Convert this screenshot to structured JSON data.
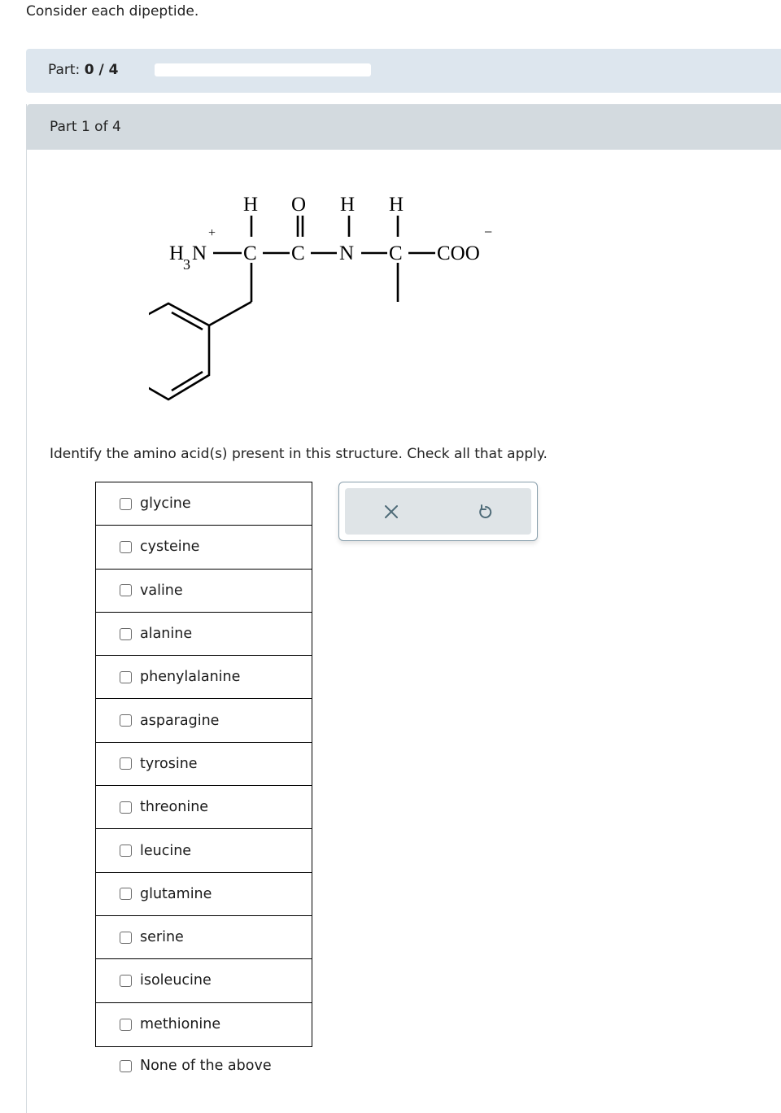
{
  "intro_text": "Consider each dipeptide.",
  "progress": {
    "label_prefix": "Part:",
    "value_text": "0 / 4",
    "completed": 0,
    "total": 4,
    "fraction": 0
  },
  "part": {
    "header": "Part 1 of 4",
    "question": "Identify the amino acid(s) present in this structure. Check all that apply.",
    "structure": {
      "top_labels": [
        "H",
        "O",
        "H",
        "H"
      ],
      "backbone_labels": [
        "N",
        "C",
        "C",
        "N",
        "C",
        "COO"
      ],
      "n_terminus": "H",
      "n_terminus_subscript": "3",
      "plus_charge": "+",
      "minus_charge": "−"
    },
    "choices": [
      {
        "label": "glycine",
        "checked": false
      },
      {
        "label": "cysteine",
        "checked": false
      },
      {
        "label": "valine",
        "checked": false
      },
      {
        "label": "alanine",
        "checked": false
      },
      {
        "label": "phenylalanine",
        "checked": false
      },
      {
        "label": "asparagine",
        "checked": false
      },
      {
        "label": "tyrosine",
        "checked": false
      },
      {
        "label": "threonine",
        "checked": false
      },
      {
        "label": "leucine",
        "checked": false
      },
      {
        "label": "glutamine",
        "checked": false
      },
      {
        "label": "serine",
        "checked": false
      },
      {
        "label": "isoleucine",
        "checked": false
      },
      {
        "label": "methionine",
        "checked": false
      }
    ],
    "none_choice": {
      "label": "None of the above",
      "checked": false
    },
    "actions": {
      "clear_icon": "x-icon",
      "undo_icon": "undo-icon",
      "icon_color": "#4f6b78"
    }
  }
}
